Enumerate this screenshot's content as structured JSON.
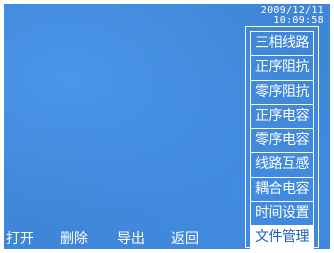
{
  "status": {
    "date": "2009/12/11",
    "time": "10:09:58"
  },
  "menu": {
    "items": [
      {
        "label": "三相线路"
      },
      {
        "label": "正序阻抗"
      },
      {
        "label": "零序阻抗"
      },
      {
        "label": "正序电容"
      },
      {
        "label": "零序电容"
      },
      {
        "label": "线路互感"
      },
      {
        "label": "耦合电容"
      },
      {
        "label": "时间设置"
      },
      {
        "label": "文件管理",
        "selected": true
      }
    ]
  },
  "softkeys": {
    "open": "打开",
    "delete": "删除",
    "export": "导出",
    "back": "返回"
  },
  "colors": {
    "screen_bg": "#3f86d8",
    "text": "#ffffff",
    "selected_bg": "#ffffff",
    "selected_text": "#1a5fbf"
  }
}
